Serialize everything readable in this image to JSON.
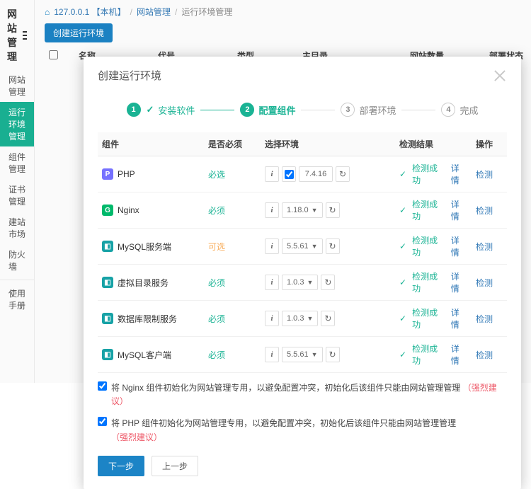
{
  "sidebar": {
    "title": "网站管理",
    "items": [
      "网站管理",
      "运行环境管理",
      "组件管理",
      "证书管理",
      "建站市场",
      "防火墙"
    ],
    "active_index": 1,
    "footer_item": "使用手册"
  },
  "breadcrumb": {
    "host": "127.0.0.1 【本机】",
    "parent": "网站管理",
    "current": "运行环境管理"
  },
  "toolbar": {
    "create_label": "创建运行环境"
  },
  "table_cols": [
    "名称",
    "代号",
    "类型",
    "主目录",
    "网站数量",
    "部署状态"
  ],
  "modal": {
    "title": "创建运行环境",
    "steps": [
      {
        "num": "1",
        "label": "安装软件",
        "state": "done"
      },
      {
        "num": "2",
        "label": "配置组件",
        "state": "active"
      },
      {
        "num": "3",
        "label": "部署环境",
        "state": "pending"
      },
      {
        "num": "4",
        "label": "完成",
        "state": "pending"
      }
    ],
    "grid_head": {
      "comp": "组件",
      "must": "是否必须",
      "env": "选择环境",
      "result": "检测结果",
      "op": "操作"
    },
    "rows": [
      {
        "icon": "b-purple",
        "icon_txt": "P",
        "name": "PHP",
        "must": "必选",
        "must_cls": "must",
        "version": "7.4.16",
        "has_dropdown": false,
        "has_check": true,
        "result": "检测成功",
        "detail": "详情",
        "op": "检测"
      },
      {
        "icon": "b-green",
        "icon_txt": "G",
        "name": "Nginx",
        "must": "必须",
        "must_cls": "must",
        "version": "1.18.0",
        "has_dropdown": true,
        "has_check": false,
        "result": "检测成功",
        "detail": "详情",
        "op": "检测"
      },
      {
        "icon": "b-teal",
        "icon_txt": "◧",
        "name": "MySQL服务端",
        "must": "可选",
        "must_cls": "opt",
        "version": "5.5.61",
        "has_dropdown": true,
        "has_check": false,
        "result": "检测成功",
        "detail": "详情",
        "op": "检测"
      },
      {
        "icon": "b-teal",
        "icon_txt": "◧",
        "name": "虚拟目录服务",
        "must": "必须",
        "must_cls": "must",
        "version": "1.0.3",
        "has_dropdown": true,
        "has_check": false,
        "result": "检测成功",
        "detail": "详情",
        "op": "检测"
      },
      {
        "icon": "b-teal",
        "icon_txt": "◧",
        "name": "数据库限制服务",
        "must": "必须",
        "must_cls": "must",
        "version": "1.0.3",
        "has_dropdown": true,
        "has_check": false,
        "result": "检测成功",
        "detail": "详情",
        "op": "检测"
      },
      {
        "icon": "b-teal",
        "icon_txt": "◧",
        "name": "MySQL客户端",
        "must": "必须",
        "must_cls": "must",
        "version": "5.5.61",
        "has_dropdown": true,
        "has_check": false,
        "result": "检测成功",
        "detail": "详情",
        "op": "检测"
      }
    ],
    "check1_pre": "将 Nginx 组件初始化为网站管理专用，以避免配置冲突，初始化后该组件只能由网站管理管理",
    "check2_pre": "将 PHP 组件初始化为网站管理专用，以避免配置冲突，初始化后该组件只能由网站管理管理",
    "strong": "（强烈建议）",
    "btn_next": "下一步",
    "btn_prev": "上一步"
  }
}
